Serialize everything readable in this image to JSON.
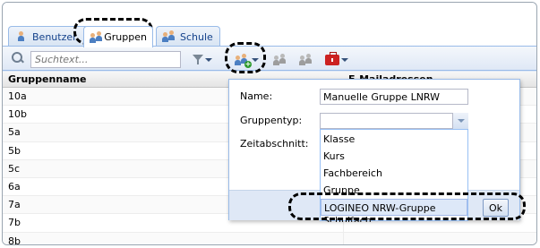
{
  "tabs": [
    {
      "label": "Benutzer",
      "icon": "user-icon",
      "active": false
    },
    {
      "label": "Gruppen",
      "icon": "group-icon",
      "active": true
    },
    {
      "label": "Schule",
      "icon": "school-icon",
      "active": false
    }
  ],
  "toolbar": {
    "search_placeholder": "Suchtext...",
    "icons": [
      "search-icon",
      "filter-icon",
      "add-group-icon",
      "edit-group-icon",
      "delete-group-icon",
      "toolbox-icon"
    ]
  },
  "grid": {
    "columns": [
      "Gruppenname",
      "E-Mailadressen"
    ],
    "rows": [
      "10a",
      "10b",
      "5a",
      "5b",
      "5c",
      "6a",
      "7a",
      "7b",
      "8b"
    ]
  },
  "form": {
    "name_label": "Name:",
    "name_value": "Manuelle Gruppe LNRW",
    "type_label": "Gruppentyp:",
    "type_value": "",
    "period_label": "Zeitabschnitt:",
    "ok_label": "Ok",
    "type_options": [
      "Klasse",
      "Kurs",
      "Fachbereich",
      "Gruppe",
      "LOGINEO NRW-Gruppe",
      "Schulfach"
    ],
    "selected_option": "LOGINEO NRW-Gruppe"
  },
  "colors": {
    "accent": "#99bbe8",
    "panel_bg": "#dfe8f6",
    "selection_bg": "#dde8f8",
    "delete_red": "#cc2222"
  }
}
